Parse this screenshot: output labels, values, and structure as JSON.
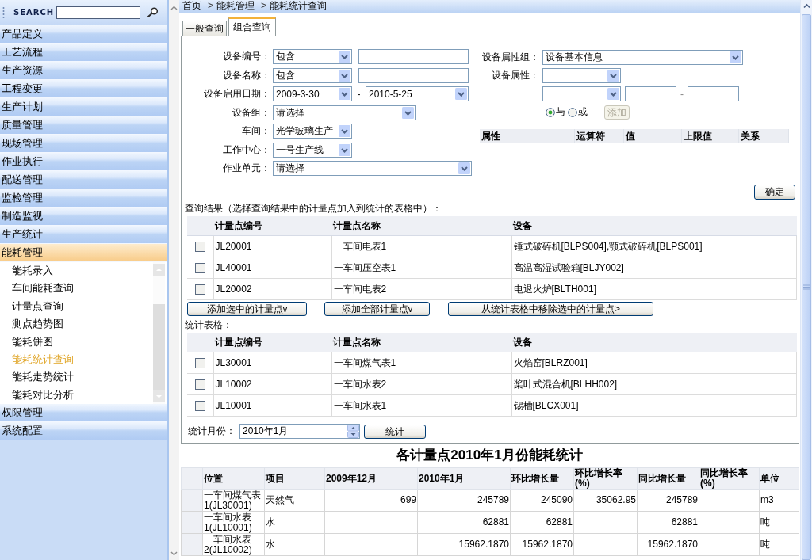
{
  "sidebar": {
    "search_label": "SEARCH",
    "items": [
      {
        "label": "产品定义",
        "expanded": false
      },
      {
        "label": "工艺流程",
        "expanded": false
      },
      {
        "label": "生产资源",
        "expanded": false
      },
      {
        "label": "工程变更",
        "expanded": false
      },
      {
        "label": "生产计划",
        "expanded": false
      },
      {
        "label": "质量管理",
        "expanded": false
      },
      {
        "label": "现场管理",
        "expanded": false
      },
      {
        "label": "作业执行",
        "expanded": false
      },
      {
        "label": "配送管理",
        "expanded": false
      },
      {
        "label": "监检管理",
        "expanded": false
      },
      {
        "label": "制造监视",
        "expanded": false
      },
      {
        "label": "生产统计",
        "expanded": false
      },
      {
        "label": "能耗管理",
        "expanded": true,
        "children": [
          {
            "label": "能耗录入",
            "selected": false
          },
          {
            "label": "车间能耗查询",
            "selected": false
          },
          {
            "label": "计量点查询",
            "selected": false
          },
          {
            "label": "测点趋势图",
            "selected": false
          },
          {
            "label": "能耗饼图",
            "selected": false
          },
          {
            "label": "能耗统计查询",
            "selected": true
          },
          {
            "label": "能耗走势统计",
            "selected": false
          },
          {
            "label": "能耗对比分析",
            "selected": false
          }
        ]
      },
      {
        "label": "权限管理",
        "expanded": false
      },
      {
        "label": "系统配置",
        "expanded": false
      }
    ]
  },
  "breadcrumb": {
    "items": [
      "首页",
      "能耗管理",
      "能耗统计查询"
    ],
    "separator": ">"
  },
  "tabs": [
    {
      "label": "一般查询",
      "selected": false
    },
    {
      "label": "组合查询",
      "selected": true
    }
  ],
  "query": {
    "fields": [
      {
        "kind": "match",
        "label": "设备编号：",
        "operator": "包含"
      },
      {
        "kind": "match",
        "label": "设备名称：",
        "operator": "包含"
      },
      {
        "kind": "date_range",
        "label": "设备启用日期：",
        "from": "2009-3-30",
        "separator": "-",
        "to": "2010-5-25"
      },
      {
        "kind": "select",
        "label": "设备组：",
        "value": "请选择"
      },
      {
        "kind": "select",
        "label": "车间：",
        "value": "光学玻璃生产"
      },
      {
        "kind": "select",
        "label": "工作中心：",
        "value": "一号生产线"
      },
      {
        "kind": "select",
        "label": "作业单元：",
        "value": "请选择"
      }
    ],
    "property_group": {
      "label": "设备属性组：",
      "value": "设备基本信息"
    },
    "property": {
      "label": "设备属性："
    },
    "range_separator": "-",
    "logic": [
      {
        "label": "与",
        "selected": true
      },
      {
        "label": "或",
        "selected": false
      }
    ],
    "add_button": {
      "label": "添加",
      "disabled": true
    },
    "conditions_columns": [
      "属性",
      "运算符",
      "值",
      "上限值",
      "关系"
    ],
    "confirm_button": "确定"
  },
  "results": {
    "title": "查询结果（选择查询结果中的计量点加入到统计的表格中）：",
    "columns": [
      "计量点编号",
      "计量点名称",
      "设备"
    ],
    "rows": [
      {
        "checked": false,
        "code": "JL20001",
        "name": "一车间电表1",
        "equipment": "锤式破碎机[BLPS004],颚式破碎机[BLPS001]"
      },
      {
        "checked": false,
        "code": "JL40001",
        "name": "一车间压空表1",
        "equipment": "高温高湿试验箱[BLJY002]"
      },
      {
        "checked": false,
        "code": "JL20002",
        "name": "一车间电表2",
        "equipment": "电退火炉[BLTH001]"
      }
    ],
    "actions": [
      "添加选中的计量点v",
      "添加全部计量点v",
      "从统计表格中移除选中的计量点>"
    ]
  },
  "statistics_table": {
    "title": "统计表格：",
    "columns": [
      "计量点编号",
      "计量点名称",
      "设备"
    ],
    "rows": [
      {
        "checked": false,
        "code": "JL30001",
        "name": "一车间煤气表1",
        "equipment": "火焰窑[BLRZ001]"
      },
      {
        "checked": false,
        "code": "JL10002",
        "name": "一车间水表2",
        "equipment": "桨叶式混合机[BLHH002]"
      },
      {
        "checked": false,
        "code": "JL10001",
        "name": "一车间水表1",
        "equipment": "锡槽[BLCX001]"
      }
    ]
  },
  "month": {
    "label": "统计月份：",
    "value": "2010年1月",
    "button": "统计"
  },
  "report": {
    "title": "各计量点2010年1月份能耗统计",
    "columns": [
      {
        "label": "位置",
        "kind": "text"
      },
      {
        "label": "项目",
        "kind": "text"
      },
      {
        "label": "2009年12月",
        "kind": "number"
      },
      {
        "label": "2010年1月",
        "kind": "number"
      },
      {
        "label": "环比增长量",
        "kind": "number"
      },
      {
        "label": "环比增长率(%)",
        "kind": "number"
      },
      {
        "label": "同比增长量",
        "kind": "number"
      },
      {
        "label": "同比增长率(%)",
        "kind": "number"
      },
      {
        "label": "单位",
        "kind": "text"
      }
    ],
    "rows": [
      [
        "一车间煤气表1(JL30001)",
        "天然气",
        "699",
        "245789",
        "245090",
        "35062.95",
        "245789",
        null,
        "m3"
      ],
      [
        "一车间水表1(JL10001)",
        "水",
        null,
        "62881",
        "62881",
        null,
        "62881",
        null,
        "吨"
      ],
      [
        "一车间水表2(JL10002)",
        "水",
        null,
        "15962.1870",
        "15962.1870",
        null,
        "15962.1870",
        null,
        "吨"
      ]
    ]
  }
}
